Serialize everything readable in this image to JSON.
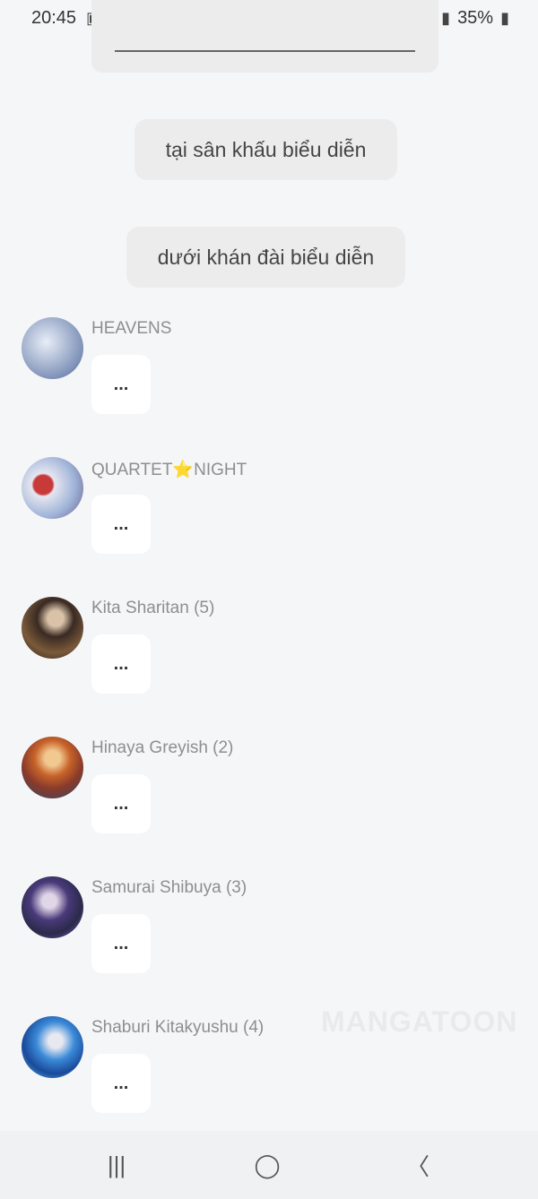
{
  "status_bar": {
    "time": "20:45",
    "battery": "35%",
    "left_icons": [
      "image-icon",
      "cloud-icon",
      "tiktok-icon",
      "dot-icon"
    ],
    "right_icons": [
      "alarm-icon",
      "mute-icon",
      "wifi-icon",
      "signal-icon",
      "signal-icon",
      "battery-icon"
    ]
  },
  "messages": {
    "center1": "tại sân khấu biểu diễn",
    "center2": "dưới khán đài biểu diễn"
  },
  "characters": [
    {
      "name": "HEAVENS",
      "message": "...",
      "avatar_color": "#a9b8d6"
    },
    {
      "name": "QUARTET⭐NIGHT",
      "message": "...",
      "avatar_color": "#c9a9c9"
    },
    {
      "name": "Kita Sharitan (5)",
      "message": "...",
      "avatar_color": "#6b4a3a"
    },
    {
      "name": "Hinaya Greyish (2)",
      "message": "...",
      "avatar_color": "#a0523a"
    },
    {
      "name": "Samurai Shibuya (3)",
      "message": "...",
      "avatar_color": "#3a3a6a"
    },
    {
      "name": "Shaburi Kitakyushu (4)",
      "message": "...",
      "avatar_color": "#3a7ac9"
    }
  ],
  "watermark": "MANGATOON",
  "nav": {
    "recent": "|||",
    "home": "◯",
    "back": "〈"
  }
}
